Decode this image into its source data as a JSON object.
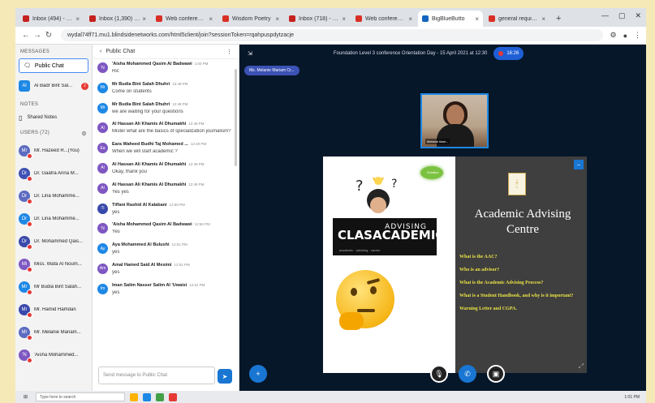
{
  "browser": {
    "tabs": [
      {
        "label": "Inbox (494) - flur",
        "favicon_color": "#c5221f"
      },
      {
        "label": "Inbox (1,390) - fu",
        "favicon_color": "#c5221f"
      },
      {
        "label": "Web conference",
        "favicon_color": "#d93025"
      },
      {
        "label": "Wisdom Poetry",
        "favicon_color": "#d93025"
      },
      {
        "label": "Inbox (718) - flur",
        "favicon_color": "#c5221f"
      },
      {
        "label": "Web conference",
        "favicon_color": "#d93025"
      },
      {
        "label": "BigBlueButto",
        "favicon_color": "#1565c0",
        "active": true
      },
      {
        "label": "general requiem",
        "favicon_color": "#d93025"
      }
    ],
    "url": "wydal74ff71.mu1.blindsidenetworks.com/html5client/join?sessionToken=rqahpuspdytzacje"
  },
  "sidebar": {
    "messages_header": "MESSAGES",
    "public_chat": "Public Chat",
    "private_chat": {
      "initials": "Al",
      "name": "Al Badr Bint Sal...",
      "badge": "2"
    },
    "notes_header": "NOTES",
    "shared_notes": "Shared Notes",
    "users_header": "USERS (72)",
    "users": [
      {
        "initials": "Mr",
        "name": "Mr. Hazeed R...(You)",
        "color": "#5c6bc0"
      },
      {
        "initials": "Dr",
        "name": "Dr. Gaafra Anna M...",
        "color": "#3f51b5"
      },
      {
        "initials": "Dr",
        "name": "Dr. Lina Mohamme...",
        "color": "#5c6bc0"
      },
      {
        "initials": "Dr",
        "name": "Dr. Lina Mohamme...",
        "color": "#1e88e5"
      },
      {
        "initials": "Dr",
        "name": "Dr. Mohammed Qais...",
        "color": "#3949ab"
      },
      {
        "initials": "Mi",
        "name": "Miss. Wafa Al Noum...",
        "color": "#7e57c2"
      },
      {
        "initials": "Mr",
        "name": "Mr Budia Bint Salah...",
        "color": "#1e88e5"
      },
      {
        "initials": "Mr",
        "name": "Mr. Hamid Hamdan",
        "color": "#3949ab"
      },
      {
        "initials": "Mr",
        "name": "Mr. Melanie Mariam...",
        "color": "#5c6bc0"
      },
      {
        "initials": "'N",
        "name": "'Aisha Mohammed...",
        "color": "#7e57c2"
      }
    ]
  },
  "chat": {
    "title": "Public Chat",
    "messages": [
      {
        "initials": "'N",
        "sender": "'Aisha Mohammed Qasim Al Badwawi",
        "time": "1:00 PM",
        "text": "Ric",
        "color": "#7e57c2"
      },
      {
        "initials": "Mr",
        "sender": "Mr Budia Bint Salah Dhuhri",
        "time": "12:48 PM",
        "text": "Come on students",
        "color": "#1e88e5"
      },
      {
        "initials": "Mr",
        "sender": "Mr Budia Bint Salah Dhuhri",
        "time": "12:48 PM",
        "text": "we are waiting for your questions",
        "color": "#1e88e5"
      },
      {
        "initials": "Al",
        "sender": "Al Hassan Ali Khamis Al Dhumakhi",
        "time": "12:49 PM",
        "text": "Mister what are the basics of specialization journalism?",
        "color": "#7e57c2"
      },
      {
        "initials": "Ea",
        "sender": "Eara Waheed Budhi Taj Mohamed ...",
        "time": "12:49 PM",
        "text": "When we will start academic ?",
        "color": "#7e57c2"
      },
      {
        "initials": "Al",
        "sender": "Al Hassan Ali Khamis Al Dhumakhi",
        "time": "12:49 PM",
        "text": "Okay, thank you",
        "color": "#7e57c2"
      },
      {
        "initials": "Al",
        "sender": "Al Hassan Ali Khamis Al Dhumakhi",
        "time": "12:49 PM",
        "text": "Yes yes",
        "color": "#7e57c2"
      },
      {
        "initials": "Ti",
        "sender": "Tiffani Rashid Al Kalabani",
        "time": "12:50 PM",
        "text": "yes",
        "color": "#3949ab"
      },
      {
        "initials": "'N",
        "sender": "'Aisha Mohammed Qasim Al Badwawi",
        "time": "12:50 PM",
        "text": "Yes",
        "color": "#7e57c2"
      },
      {
        "initials": "Ay",
        "sender": "Aya Mohammed Al Bulushi",
        "time": "12:51 PM",
        "text": "yes",
        "color": "#1e88e5"
      },
      {
        "initials": "Am",
        "sender": "Amal Hamed Said Al Mesimi",
        "time": "12:51 PM",
        "text": "yes",
        "color": "#7e57c2"
      },
      {
        "initials": "Im",
        "sender": "Iman Salim Nasser Salim Al 'Uwaisi",
        "time": "12:51 PM",
        "text": "yes",
        "color": "#1e88e5"
      }
    ],
    "input_placeholder": "Send message to Public Chat"
  },
  "presentation": {
    "conference_title": "Foundation Level 3 conference Orientation Day - 15 April 2021 at 12:30",
    "recording_label": "16:26",
    "presenter_label": "Ms. Melanie Mariam Cr...",
    "webcam_label": "Melanie Mari...",
    "slide": {
      "left_graphic_text": "ADVISING",
      "left_graphic_big": "CLASACADEMIC",
      "left_graphic_small": "academic · advising · career",
      "bulb_text": "Solution",
      "logo_glyph": "🕯",
      "title": "Academic Advising Centre",
      "items": [
        "What is the AAC?",
        "Who is an advisor?",
        "What is the Academic Advising Process?",
        "What is a Student Handbook, and why is it important?",
        "Warning Letter and CGPA."
      ]
    }
  },
  "taskbar": {
    "search_placeholder": "Type here to search",
    "clock": "1:01 PM"
  }
}
